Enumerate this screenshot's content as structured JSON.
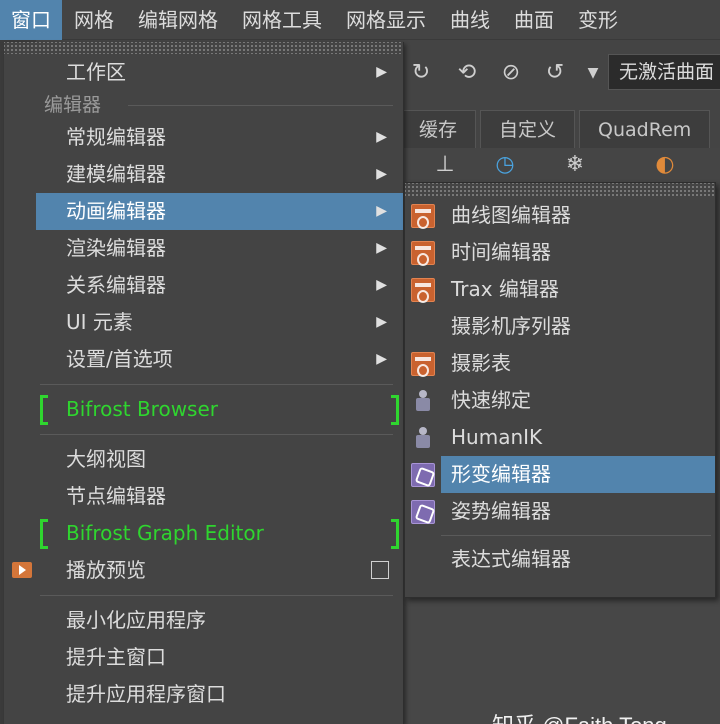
{
  "menubar": {
    "items": [
      "窗口",
      "网格",
      "编辑网格",
      "网格工具",
      "网格显示",
      "曲线",
      "曲面",
      "变形"
    ]
  },
  "background": {
    "mode_dropdown": "无激活曲面",
    "shelf_tabs": [
      "缓存",
      "自定义",
      "QuadRem"
    ],
    "watermark": "知乎 @Faith Tong"
  },
  "main_menu": {
    "workspace": "工作区",
    "editors_section": "编辑器",
    "items_group1": [
      "常规编辑器",
      "建模编辑器",
      "动画编辑器",
      "渲染编辑器",
      "关系编辑器",
      "UI 元素",
      "设置/首选项"
    ],
    "bifrost_browser": "Bifrost Browser",
    "items_group2": [
      "大纲视图",
      "节点编辑器"
    ],
    "bifrost_graph": "Bifrost Graph Editor",
    "playblast": "播放预览",
    "items_group3": [
      "最小化应用程序",
      "提升主窗口",
      "提升应用程序窗口"
    ]
  },
  "sub_menu": {
    "items": [
      "曲线图编辑器",
      "时间编辑器",
      "Trax 编辑器",
      "摄影机序列器",
      "摄影表",
      "快速绑定",
      "HumanIK",
      "形变编辑器",
      "姿势编辑器"
    ],
    "expression_editor": "表达式编辑器"
  },
  "colors": {
    "highlight": "#5284ad",
    "menu_bg": "#444444",
    "bifrost_green": "#2fd52f"
  }
}
